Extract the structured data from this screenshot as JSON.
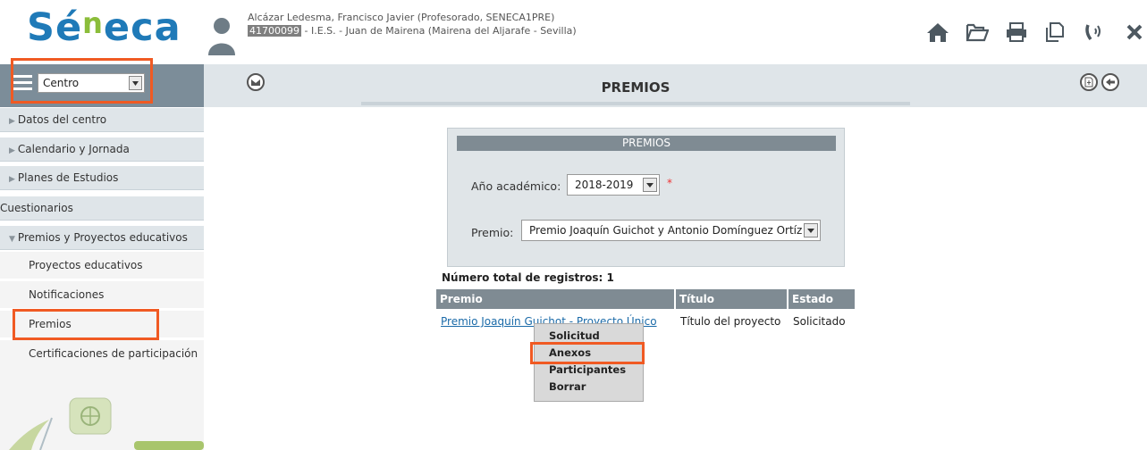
{
  "app": {
    "logo": "Séneca"
  },
  "user": {
    "name": "Alcázar Ledesma, Francisco Javier (Profesorado, SENECA1PRE)",
    "center_code": "41700099",
    "center_name": " - I.E.S. - Juan de Mairena (Mairena del Aljarafe - Sevilla)"
  },
  "header_icons": [
    "home-icon",
    "folder-open-icon",
    "printer-icon",
    "copy-icon",
    "phone-icon",
    "close-icon"
  ],
  "sidebar": {
    "combo_value": "Centro",
    "items": [
      {
        "label": "Datos del centro"
      },
      {
        "label": "Calendario y Jornada"
      },
      {
        "label": "Planes de Estudios"
      },
      {
        "label": "Cuestionarios"
      },
      {
        "label": "Premios y Proyectos educativos"
      }
    ],
    "subitems": [
      {
        "label": "Proyectos educativos"
      },
      {
        "label": "Notificaciones"
      },
      {
        "label": "Premios"
      },
      {
        "label": "Certificaciones de participación"
      }
    ]
  },
  "page": {
    "title": "PREMIOS"
  },
  "form": {
    "header": "PREMIOS",
    "year_label": "Año académico:",
    "year_value": "2018-2019",
    "required_mark": "*",
    "premio_label": "Premio:",
    "premio_value": "Premio Joaquín Guichot y Antonio Domínguez Ortíz"
  },
  "results": {
    "total": "Número total de registros: 1",
    "columns": [
      "Premio",
      "Título",
      "Estado"
    ],
    "rows": [
      {
        "premio": "Premio Joaquín Guichot - Proyecto Único",
        "titulo": "Título del proyecto",
        "estado": "Solicitado"
      }
    ]
  },
  "context_menu": {
    "items": [
      "Solicitud",
      "Anexos",
      "Participantes",
      "Borrar"
    ]
  },
  "colors": {
    "highlight": "#f05a23",
    "bar": "#7f8b93",
    "brand_blue": "#1f7ab8",
    "brand_green": "#8bbd3a"
  }
}
